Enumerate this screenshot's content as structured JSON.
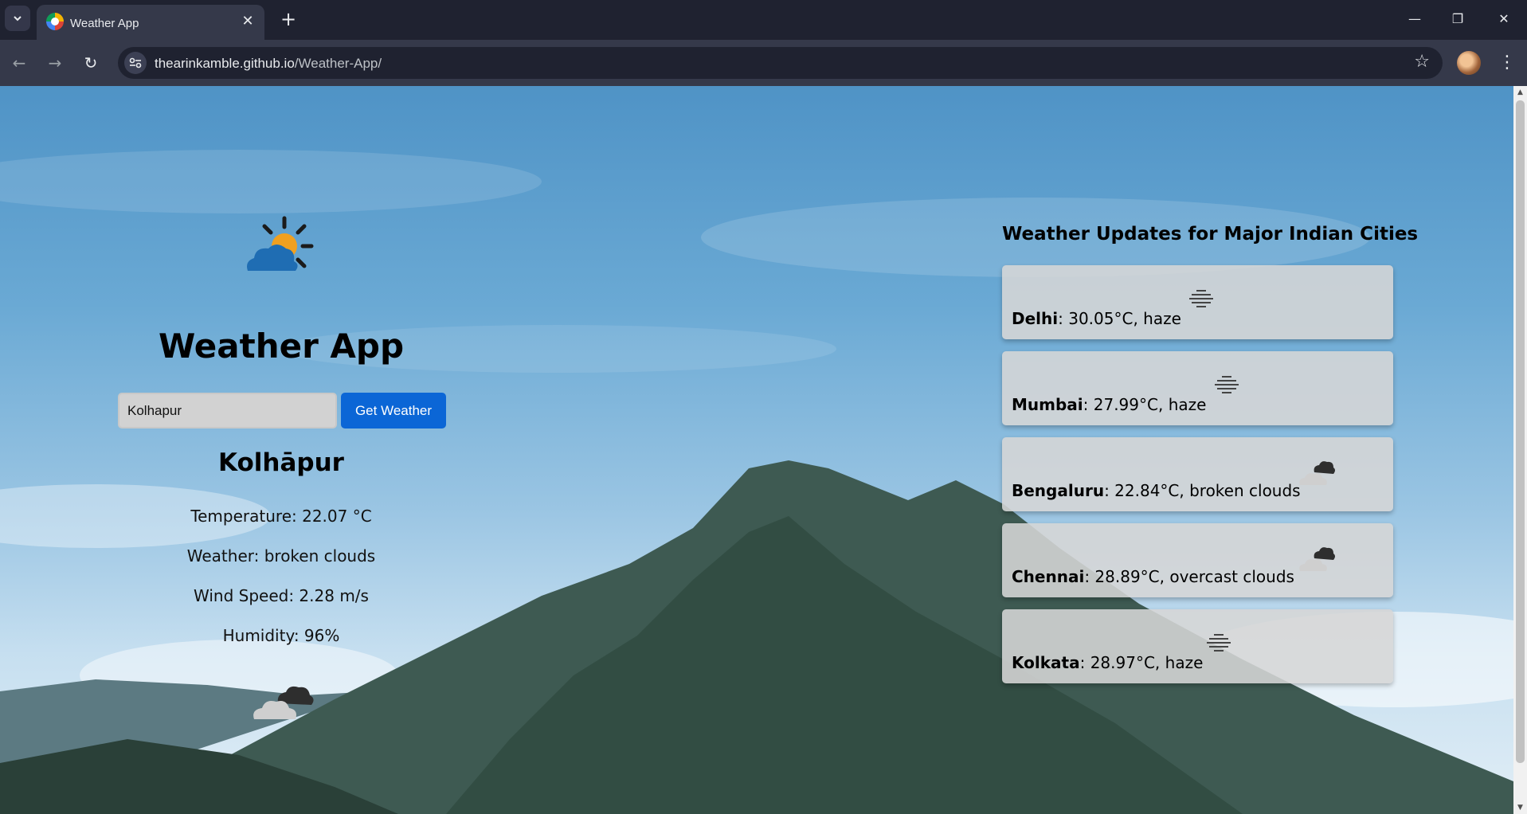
{
  "browser": {
    "tab_title": "Weather App",
    "url_host": "thearinkamble.github.io",
    "url_path": "/Weather-App/"
  },
  "app": {
    "title": "Weather App",
    "search": {
      "value": "Kolhapur",
      "button_label": "Get Weather"
    },
    "result": {
      "city": "Kolhāpur",
      "temperature": "Temperature: 22.07 °C",
      "weather": "Weather: broken clouds",
      "wind": "Wind Speed: 2.28 m/s",
      "humidity": "Humidity: 96%",
      "icon": "broken-clouds-icon"
    }
  },
  "updates": {
    "title": "Weather Updates for Major Indian Cities",
    "cities": [
      {
        "name": "Delhi",
        "detail": ": 30.05°C, haze",
        "icon": "haze-icon"
      },
      {
        "name": "Mumbai",
        "detail": ": 27.99°C, haze",
        "icon": "haze-icon"
      },
      {
        "name": "Bengaluru",
        "detail": ": 22.84°C, broken clouds",
        "icon": "broken-clouds-icon"
      },
      {
        "name": "Chennai",
        "detail": ": 28.89°C, overcast clouds",
        "icon": "overcast-clouds-icon"
      },
      {
        "name": "Kolkata",
        "detail": ": 28.97°C, haze",
        "icon": "haze-icon"
      }
    ]
  },
  "colors": {
    "button": "#0b66d6",
    "card_bg": "#d6d6d6",
    "sun": "#f0a020",
    "cloud": "#1f6db3"
  }
}
